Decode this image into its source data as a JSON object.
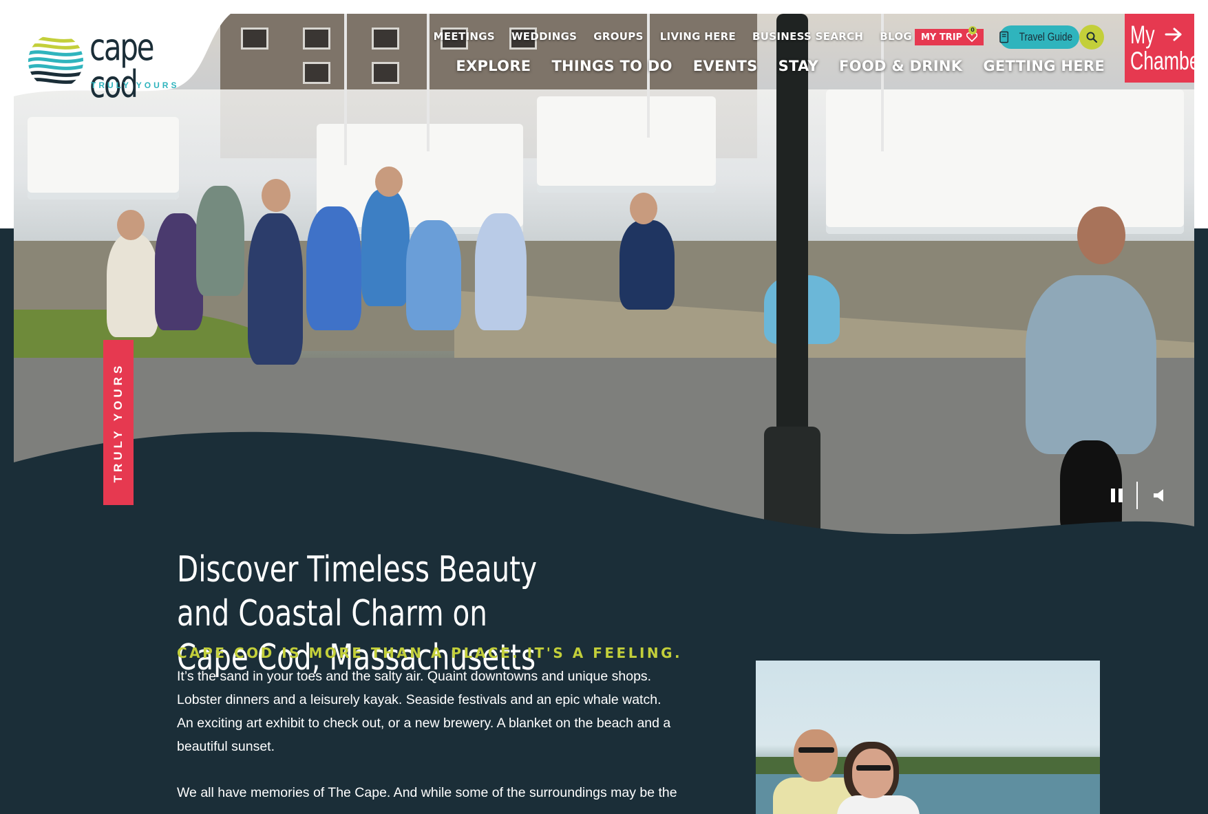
{
  "brand": {
    "name": "cape cod",
    "tagline": "TRULY YOURS",
    "colors": {
      "navy": "#1b2e38",
      "teal": "#2fb4bd",
      "red": "#e63950",
      "lime": "#c3cf3a"
    }
  },
  "utility_nav": [
    "MEETINGS",
    "WEDDINGS",
    "GROUPS",
    "LIVING HERE",
    "BUSINESS SEARCH",
    "BLOG"
  ],
  "my_trip": {
    "label": "MY TRIP",
    "count": "0",
    "icon": "heart-icon"
  },
  "travel_guide": {
    "label": "Travel Guide",
    "icon": "book-icon"
  },
  "search": {
    "icon": "search-icon"
  },
  "main_nav": [
    "EXPLORE",
    "THINGS TO DO",
    "EVENTS",
    "STAY",
    "FOOD & DRINK",
    "GETTING HERE"
  ],
  "chamber": {
    "line1": "My",
    "line2": "Chamber",
    "icon": "arrow-right-icon"
  },
  "hero": {
    "side_badge": "TRULY YOURS",
    "controls": {
      "pause_icon": "pause-icon",
      "mute_icon": "speaker-icon"
    }
  },
  "content": {
    "headline": "Discover Timeless Beauty and Coastal Charm on Cape Cod, Massachusetts",
    "tagline": "CAPE COD IS MORE THAN A PLACE. IT'S A FEELING.",
    "paragraph1": "It’s the sand in your toes and the salty air. Quaint downtowns and unique shops. Lobster dinners and a leisurely kayak. Seaside festivals and an epic whale watch. An exciting art exhibit to check out, or a new brewery. A blanket on the beach and a beautiful sunset.",
    "paragraph2": "We all have memories of The Cape. And while some of the surroundings may be the"
  }
}
